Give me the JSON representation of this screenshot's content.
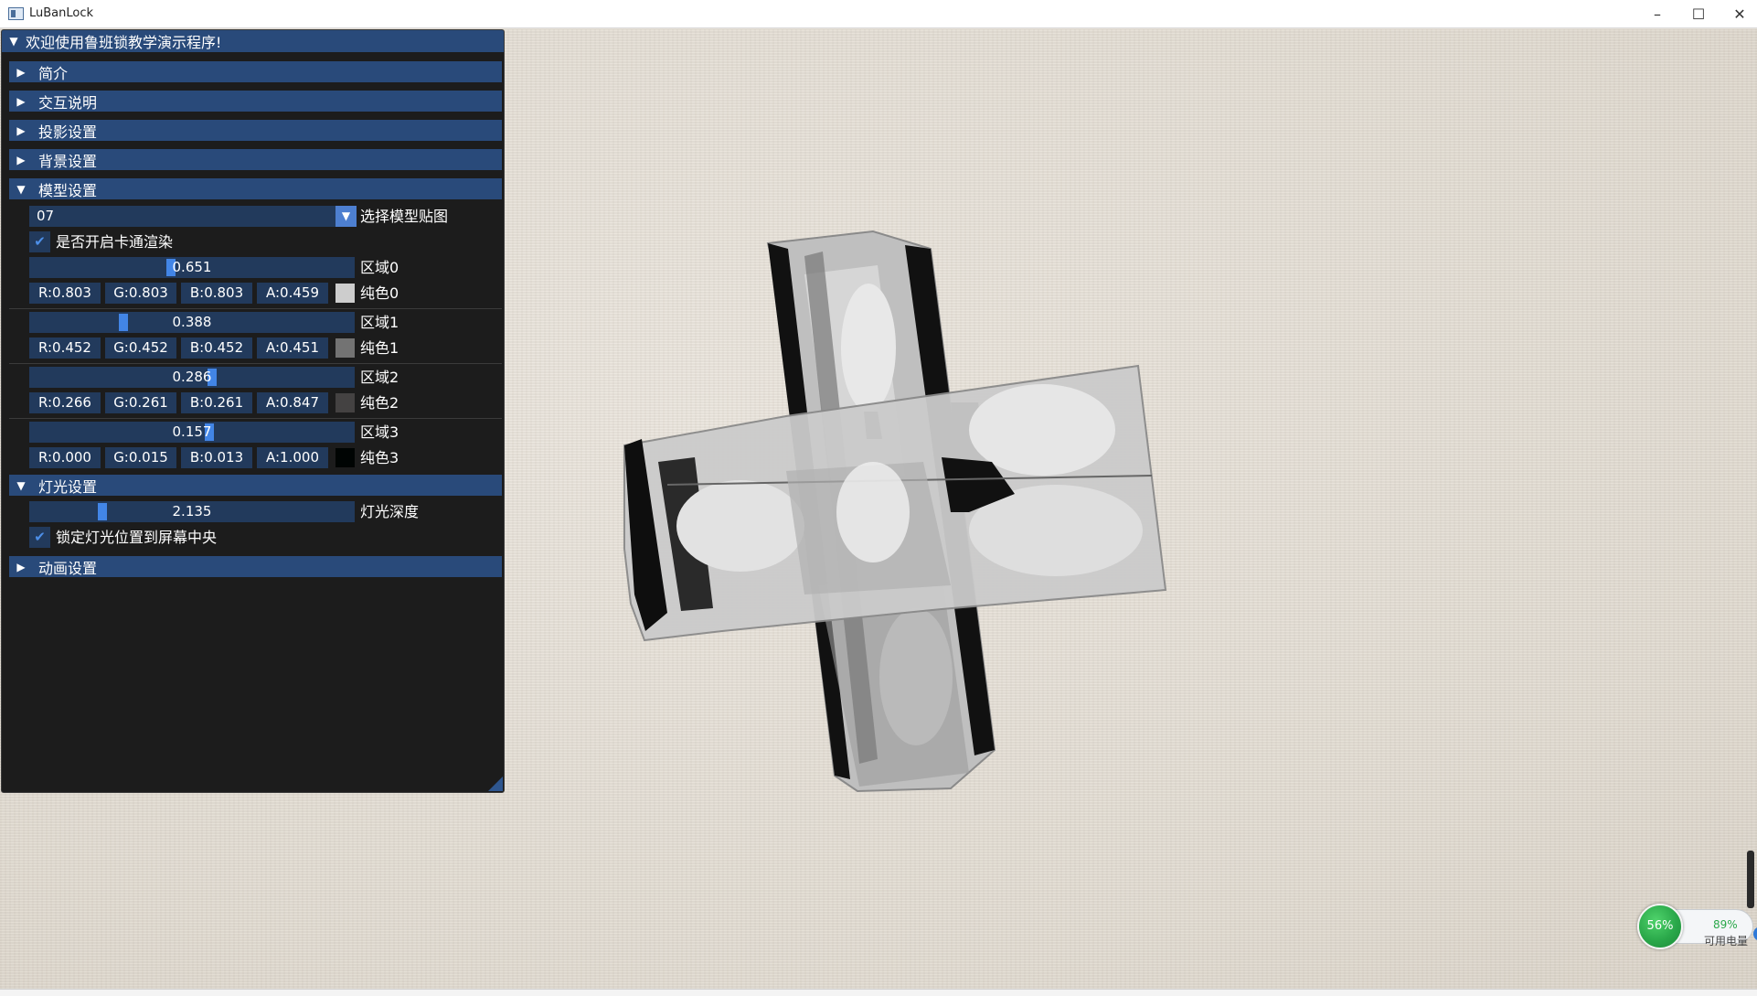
{
  "window": {
    "title": "LuBanLock",
    "min_label": "–",
    "max_label": "☐",
    "close_label": "✕"
  },
  "panel": {
    "title": "欢迎使用鲁班锁教学演示程序!",
    "sections": {
      "intro": "简介",
      "interaction": "交互说明",
      "projection": "投影设置",
      "background": "背景设置",
      "model": "模型设置",
      "light": "灯光设置",
      "animation": "动画设置"
    },
    "model": {
      "texture_value": "07",
      "texture_label": "选择模型贴图",
      "toon_label": "是否开启卡通渲染",
      "toon_checked": true,
      "regions": [
        {
          "slider_value": "0.651",
          "fraction": 0.651,
          "region_label": "区域0",
          "r": "R:0.803",
          "g": "G:0.803",
          "b": "B:0.803",
          "a": "A:0.459",
          "color_label": "纯色0",
          "swatch": "#cdcdcd"
        },
        {
          "slider_value": "0.388",
          "fraction": 0.388,
          "region_label": "区域1",
          "r": "R:0.452",
          "g": "G:0.452",
          "b": "B:0.452",
          "a": "A:0.451",
          "color_label": "纯色1",
          "swatch": "#737373"
        },
        {
          "slider_value": "0.286",
          "fraction": 0.286,
          "region_label": "区域2",
          "r": "R:0.266",
          "g": "G:0.261",
          "b": "B:0.261",
          "a": "A:0.847",
          "color_label": "纯色2",
          "swatch": "#444242"
        },
        {
          "slider_value": "0.157",
          "fraction": 0.157,
          "region_label": "区域3",
          "r": "R:0.000",
          "g": "G:0.015",
          "b": "B:0.013",
          "a": "A:1.000",
          "color_label": "纯色3",
          "swatch": "#000403"
        }
      ]
    },
    "light": {
      "depth_value": "2.135",
      "depth_fraction": 0.213,
      "depth_label": "灯光深度",
      "lock_label": "锁定灯光位置到屏幕中央",
      "lock_checked": true
    }
  },
  "battery": {
    "ball_percent": "56%",
    "percent": "89%",
    "label": "可用电量",
    "plus": "+"
  },
  "colors": {
    "header_bg": "#294a7a",
    "frame_bg": "#223a5c",
    "slider_grab": "#4285e6",
    "panel_bg": "#1c1c1c"
  }
}
